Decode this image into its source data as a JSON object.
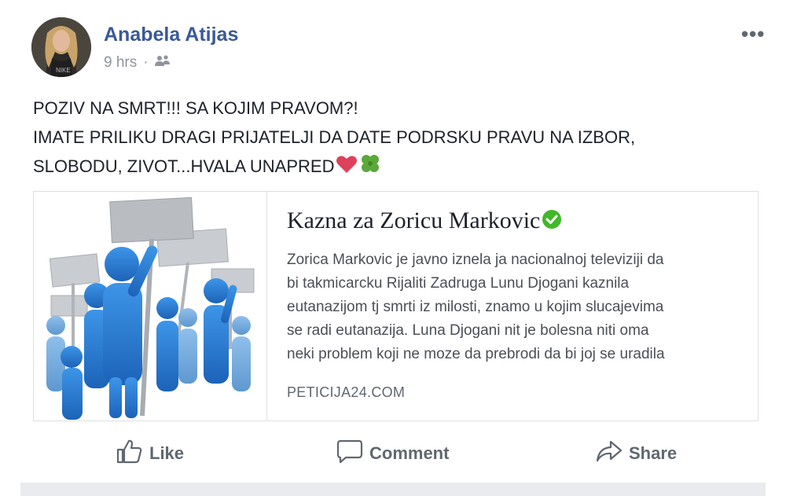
{
  "post": {
    "author": "Anabela Atijas",
    "time": "9 hrs",
    "separator": "·",
    "audience_icon": "friends-icon",
    "menu_label": "•••",
    "text_lines": [
      "POZIV NA SMRT!!! SA KOJIM PRAVOM?!",
      "IMATE PRILIKU DRAGI PRIJATELJI DA DATE PODRSKU PRAVU NA IZBOR,",
      "SLOBODU, ZIVOT...HVALA UNAPRED"
    ],
    "emojis": [
      "red-heart-icon",
      "four-leaf-clover-icon"
    ]
  },
  "link_card": {
    "title": "Kazna za Zoricu Markovic",
    "verified_icon": "verified-check-icon",
    "description_lines": [
      "Zorica Markovic je javno iznela ja nacionalnoj televiziji da",
      "bi takmicarcku Rijaliti Zadruga Lunu Djogani kaznila",
      "eutanazijom tj smrti iz milosti, znamo u kojim slucajevima",
      "se radi eutanazija. Luna Djogani nit je bolesna niti oma",
      "neki problem koji ne moze da prebrodi da bi joj se uradila"
    ],
    "domain": "PETICIJA24.COM",
    "image_icon": "protesters-with-signs-illustration"
  },
  "actions": {
    "like": "Like",
    "comment": "Comment",
    "share": "Share"
  },
  "colors": {
    "name_blue": "#3b5998",
    "meta_gray": "#90949c",
    "text": "#1d2129",
    "action_gray": "#606770",
    "figure_blue": "#2b7fd6",
    "sign_gray": "#b9bdc2",
    "verified_green": "#42b72a"
  }
}
